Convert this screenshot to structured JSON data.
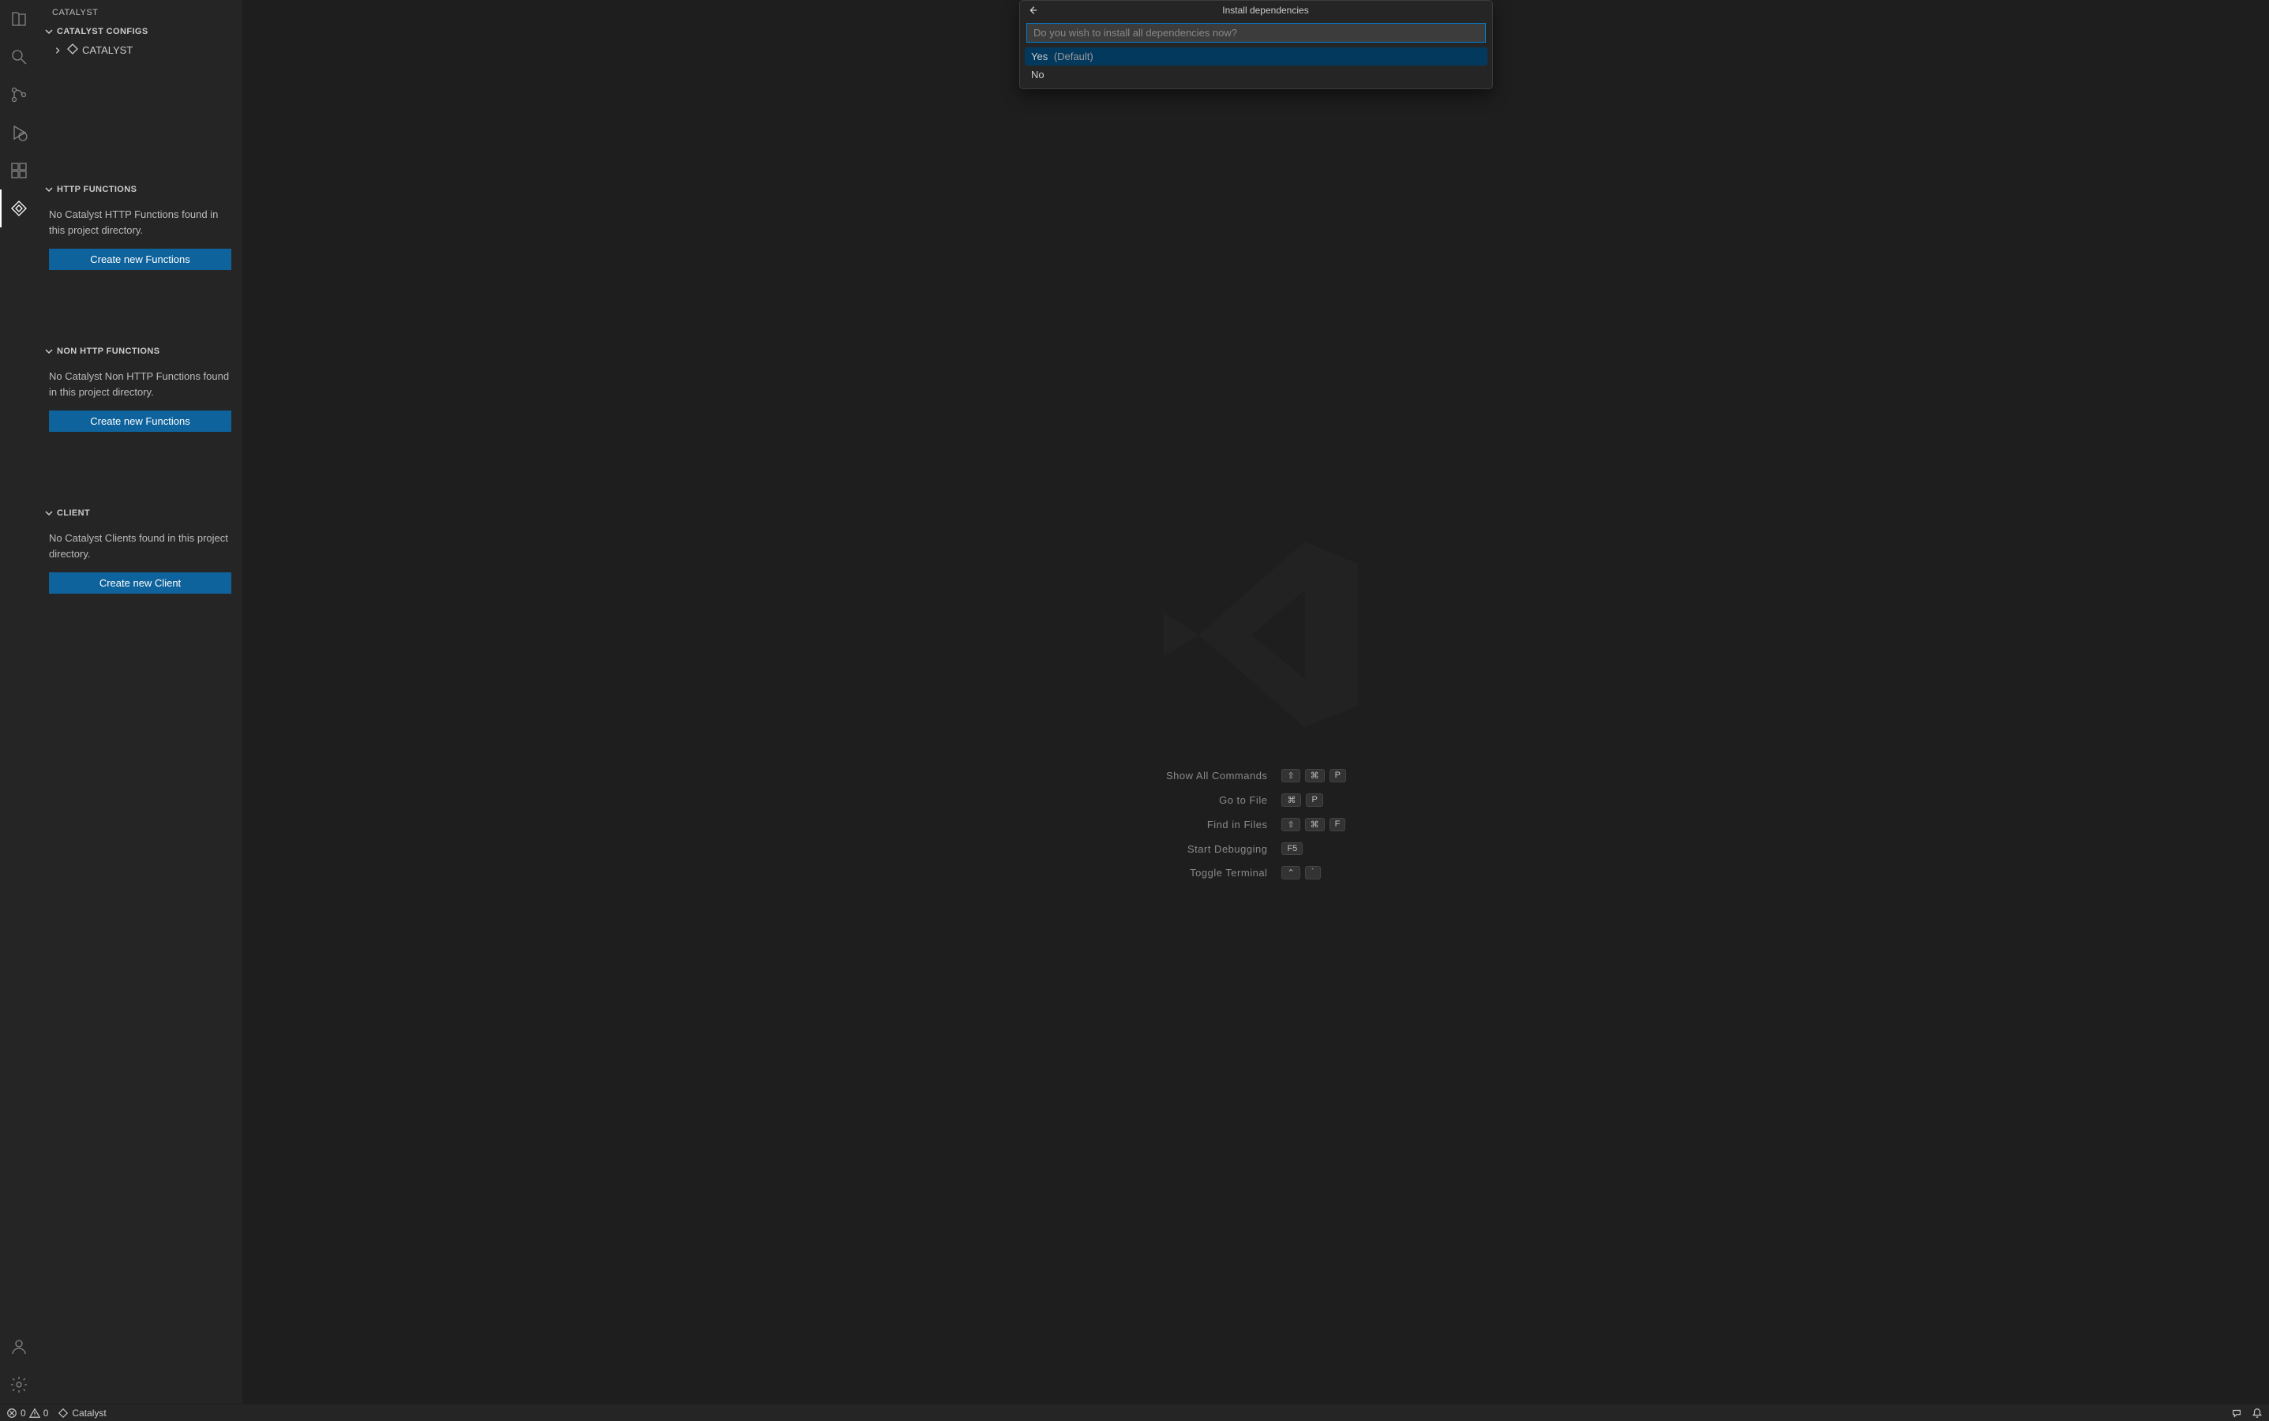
{
  "sidebar_title": "CATALYST",
  "sections": {
    "configs": {
      "header": "CATALYST CONFIGS",
      "project_name": "CATALYST"
    },
    "http": {
      "header": "HTTP FUNCTIONS",
      "msg": "No Catalyst HTTP Functions found in this project directory.",
      "btn": "Create new Functions"
    },
    "nonhttp": {
      "header": "NON HTTP FUNCTIONS",
      "msg": "No Catalyst Non HTTP Functions found in this project directory.",
      "btn": "Create new Functions"
    },
    "client": {
      "header": "CLIENT",
      "msg": "No Catalyst Clients found in this project directory.",
      "btn": "Create new Client"
    }
  },
  "quickpick": {
    "title": "Install dependencies",
    "placeholder": "Do you wish to install all dependencies now?",
    "opt_yes": "Yes",
    "opt_yes_hint": "(Default)",
    "opt_no": "No"
  },
  "shortcuts": [
    {
      "label": "Show All Commands",
      "keys": [
        "⇧",
        "⌘",
        "P"
      ]
    },
    {
      "label": "Go to File",
      "keys": [
        "⌘",
        "P"
      ]
    },
    {
      "label": "Find in Files",
      "keys": [
        "⇧",
        "⌘",
        "F"
      ]
    },
    {
      "label": "Start Debugging",
      "keys": [
        "F5"
      ]
    },
    {
      "label": "Toggle Terminal",
      "keys": [
        "⌃",
        "`"
      ]
    }
  ],
  "status": {
    "errors": "0",
    "warnings": "0",
    "catalyst": "Catalyst"
  }
}
